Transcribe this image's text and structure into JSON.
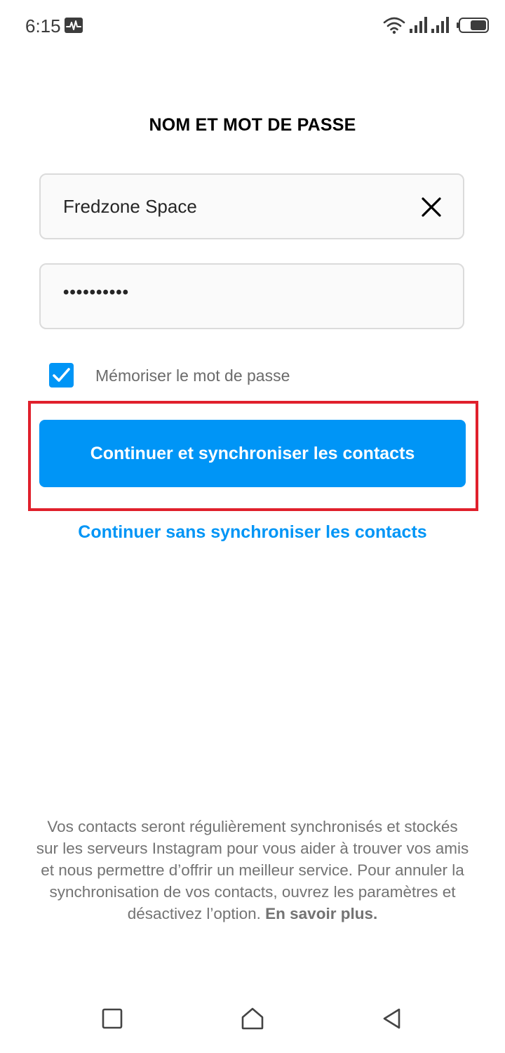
{
  "status_bar": {
    "time": "6:15",
    "icons": [
      "activity-icon",
      "wifi-icon",
      "signal-icon",
      "signal-icon",
      "battery-icon"
    ]
  },
  "form": {
    "title": "NOM ET MOT DE PASSE",
    "username": {
      "value": "Fredzone Space",
      "clear_icon": "close-icon"
    },
    "password": {
      "value": "••••••••••"
    },
    "remember": {
      "checked": true,
      "label": "Mémoriser le mot de passe"
    },
    "primary_button_label": "Continuer et synchroniser les contacts",
    "secondary_link_label": "Continuer sans synchroniser les contacts"
  },
  "footer": {
    "disclaimer": "Vos contacts seront régulièrement synchronisés et stockés sur les serveurs Instagram pour vous aider à trouver vos amis et nous permettre d’offrir un meilleur service. Pour annuler la synchronisation de vos contacts, ouvrez les paramètres et désactivez l’option.",
    "learn_more": "En savoir plus."
  },
  "nav_bar": {
    "icons": [
      "recent-apps-icon",
      "home-icon",
      "back-icon"
    ]
  },
  "colors": {
    "accent": "#0095f6",
    "highlight": "#e0202c",
    "field_border": "#dbdbdb",
    "field_background": "#fafafa",
    "muted_text": "#737373"
  }
}
